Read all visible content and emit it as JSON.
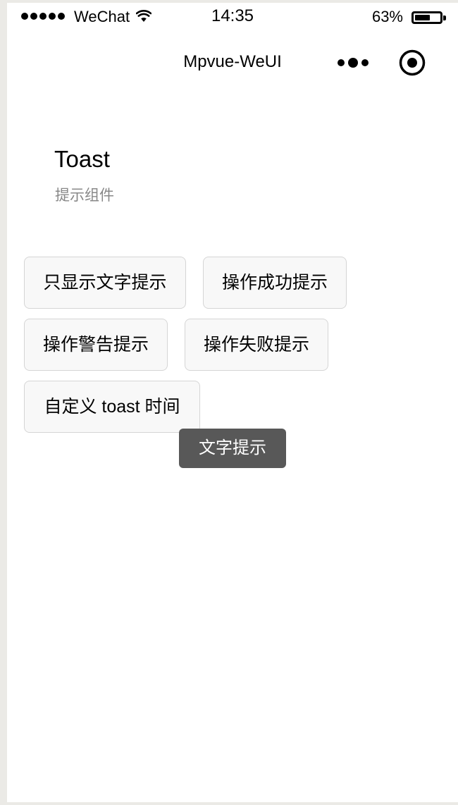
{
  "status_bar": {
    "carrier": "WeChat",
    "time": "14:35",
    "battery_percent": "63%",
    "battery_level": 0.63,
    "icons": [
      "signal-dots-icon",
      "wifi-icon",
      "battery-icon"
    ]
  },
  "navbar": {
    "title": "Mpvue-WeUI",
    "icons": [
      "more-icon",
      "record-icon"
    ]
  },
  "page": {
    "title": "Toast",
    "description": "提示组件"
  },
  "buttons": {
    "text_only": "只显示文字提示",
    "success": "操作成功提示",
    "warning": "操作警告提示",
    "fail": "操作失败提示",
    "custom_time": "自定义 toast 时间"
  },
  "toast": {
    "text": "文字提示"
  }
}
